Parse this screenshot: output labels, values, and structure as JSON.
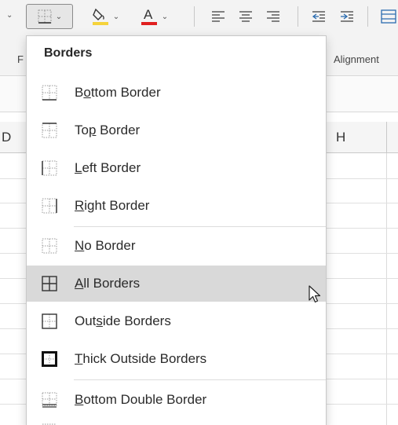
{
  "ribbon": {
    "font_group_label_fragment": "F",
    "alignment_group_label": "Alignment",
    "icons": {
      "borders": "borders-icon",
      "fill_color": "fill-color-icon",
      "font_color": "font-color-icon",
      "align_left": "align-left-icon",
      "align_center": "align-center-icon",
      "align_right": "align-right-icon",
      "decrease_indent": "decrease-indent-icon",
      "increase_indent": "increase-indent-icon",
      "merge": "merge-center-icon"
    },
    "colors": {
      "fill_highlight": "#f5d33b",
      "font_color_bar": "#e02020",
      "merge_accent": "#2b6cb0"
    }
  },
  "grid": {
    "col_header_left_fragment": "D",
    "col_header_h": "H"
  },
  "menu": {
    "title": "Borders",
    "items": [
      {
        "label_pre": "B",
        "label_ul": "o",
        "label_post": "ttom Border",
        "icon": "bottom-border-icon"
      },
      {
        "label_pre": "To",
        "label_ul": "p",
        "label_post": " Border",
        "icon": "top-border-icon"
      },
      {
        "label_pre": "",
        "label_ul": "L",
        "label_post": "eft Border",
        "icon": "left-border-icon"
      },
      {
        "label_pre": "",
        "label_ul": "R",
        "label_post": "ight Border",
        "icon": "right-border-icon"
      },
      {
        "label_pre": "",
        "label_ul": "N",
        "label_post": "o Border",
        "icon": "no-border-icon"
      },
      {
        "label_pre": "",
        "label_ul": "A",
        "label_post": "ll Borders",
        "icon": "all-borders-icon",
        "hovered": true
      },
      {
        "label_pre": "Out",
        "label_ul": "s",
        "label_post": "ide Borders",
        "icon": "outside-borders-icon"
      },
      {
        "label_pre": "",
        "label_ul": "T",
        "label_post": "hick Outside Borders",
        "icon": "thick-outside-borders-icon"
      },
      {
        "label_pre": "",
        "label_ul": "B",
        "label_post": "ottom Double Border",
        "icon": "bottom-double-border-icon"
      }
    ],
    "hover_color": "#d9d9d9"
  },
  "cursor_icon": "mouse-pointer-icon"
}
